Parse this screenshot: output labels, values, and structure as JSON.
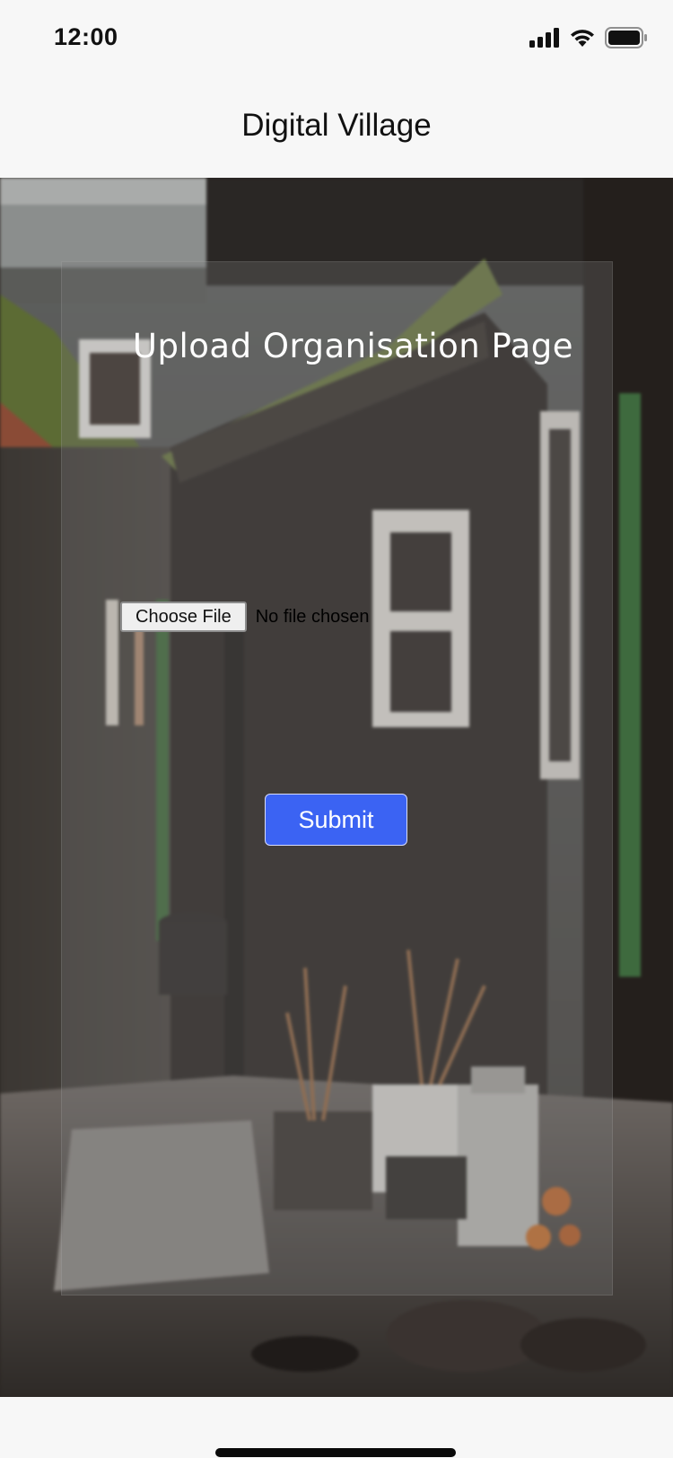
{
  "status_bar": {
    "time": "12:00",
    "icons": [
      "cellular-signal-icon",
      "wifi-icon",
      "battery-icon"
    ]
  },
  "nav": {
    "title": "Digital Village"
  },
  "form": {
    "title": "Upload Organisation Page",
    "file_button_label": "Choose File",
    "file_status": "No file chosen",
    "submit_label": "Submit"
  },
  "colors": {
    "submit_background": "#3b63f3",
    "card_overlay": "rgba(120,120,120,0.30)",
    "chrome_background": "#f7f7f7"
  }
}
